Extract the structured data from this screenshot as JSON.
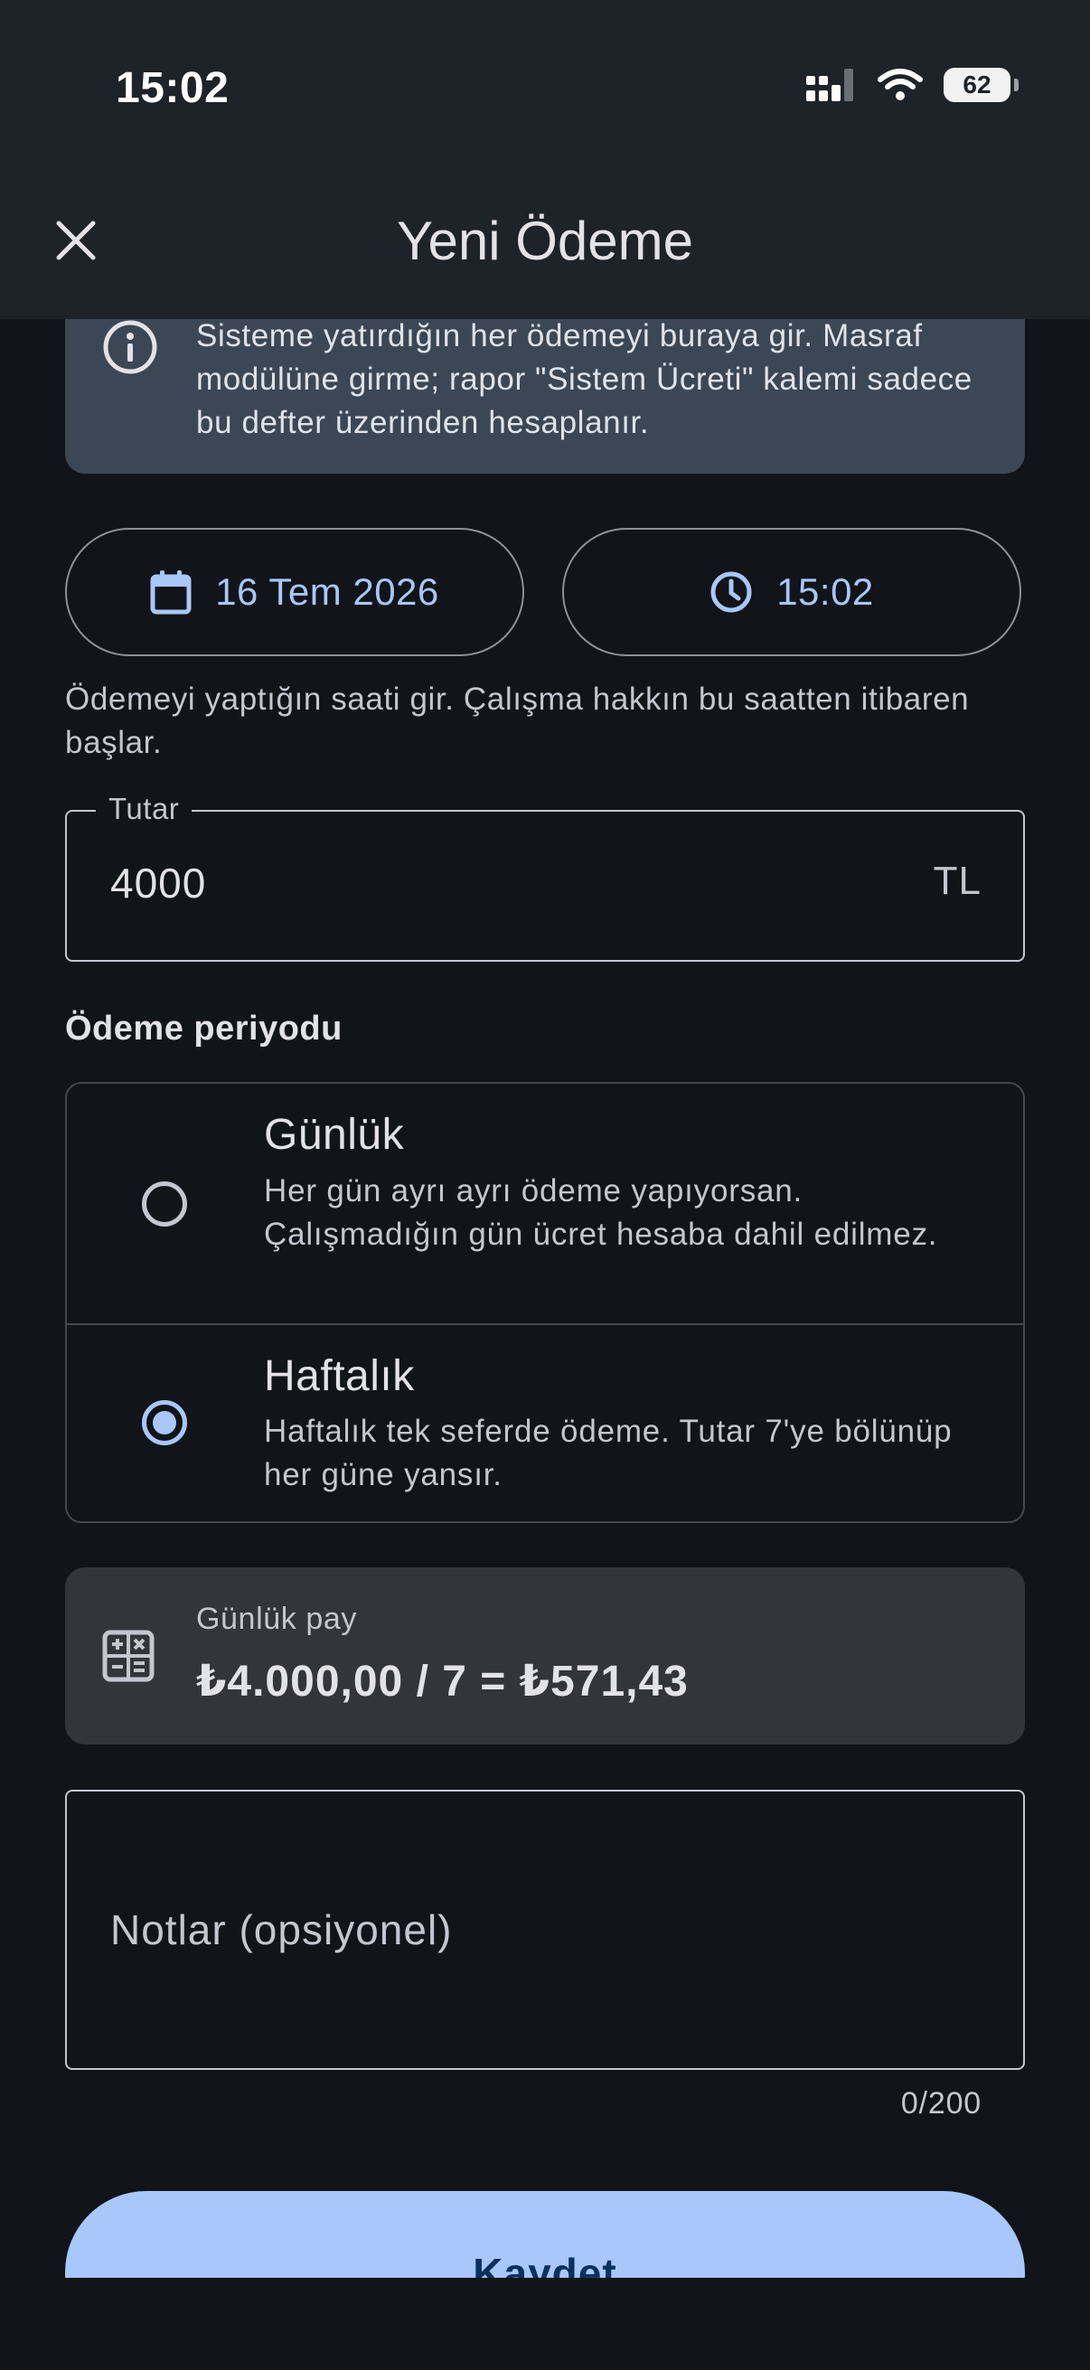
{
  "status_bar": {
    "time": "15:02",
    "battery": "62"
  },
  "app_bar": {
    "title": "Yeni Ödeme",
    "close_icon": "close-icon"
  },
  "info_banner": {
    "icon": "info-icon",
    "text": "Sisteme yatırdığın her ödemeyi buraya gir. Masraf modülüne girme; rapor \"Sistem Ücreti\" kalemi sadece bu defter üzerinden hesaplanır."
  },
  "date_button": {
    "label": "16 Tem 2026",
    "icon": "calendar-icon"
  },
  "time_button": {
    "label": "15:02",
    "icon": "clock-icon"
  },
  "helper_text": "Ödemeyi yaptığın saati gir. Çalışma hakkın bu saatten itibaren başlar.",
  "amount_field": {
    "label": "Tutar",
    "value": "4000",
    "suffix": "TL"
  },
  "period": {
    "title": "Ödeme periyodu",
    "options": [
      {
        "title": "Günlük",
        "description": "Her gün ayrı ayrı ödeme yapıyorsan. Çalışmadığın gün ücret hesaba dahil edilmez.",
        "selected": false
      },
      {
        "title": "Haftalık",
        "description": "Haftalık tek seferde ödeme. Tutar 7'ye bölünüp her güne yansır.",
        "selected": true
      }
    ]
  },
  "daily_share": {
    "icon": "calculator-icon",
    "label": "Günlük pay",
    "value": "₺4.000,00 / 7 = ₺571,43"
  },
  "notes": {
    "placeholder": "Notlar (opsiyonel)",
    "counter": "0/200"
  },
  "save_button": {
    "label": "Kaydet"
  },
  "colors": {
    "background": "#111418",
    "surface": "#1e2329",
    "accent": "#a8c7fa",
    "info_bg": "#3c4756",
    "card_bg": "#33353a"
  }
}
